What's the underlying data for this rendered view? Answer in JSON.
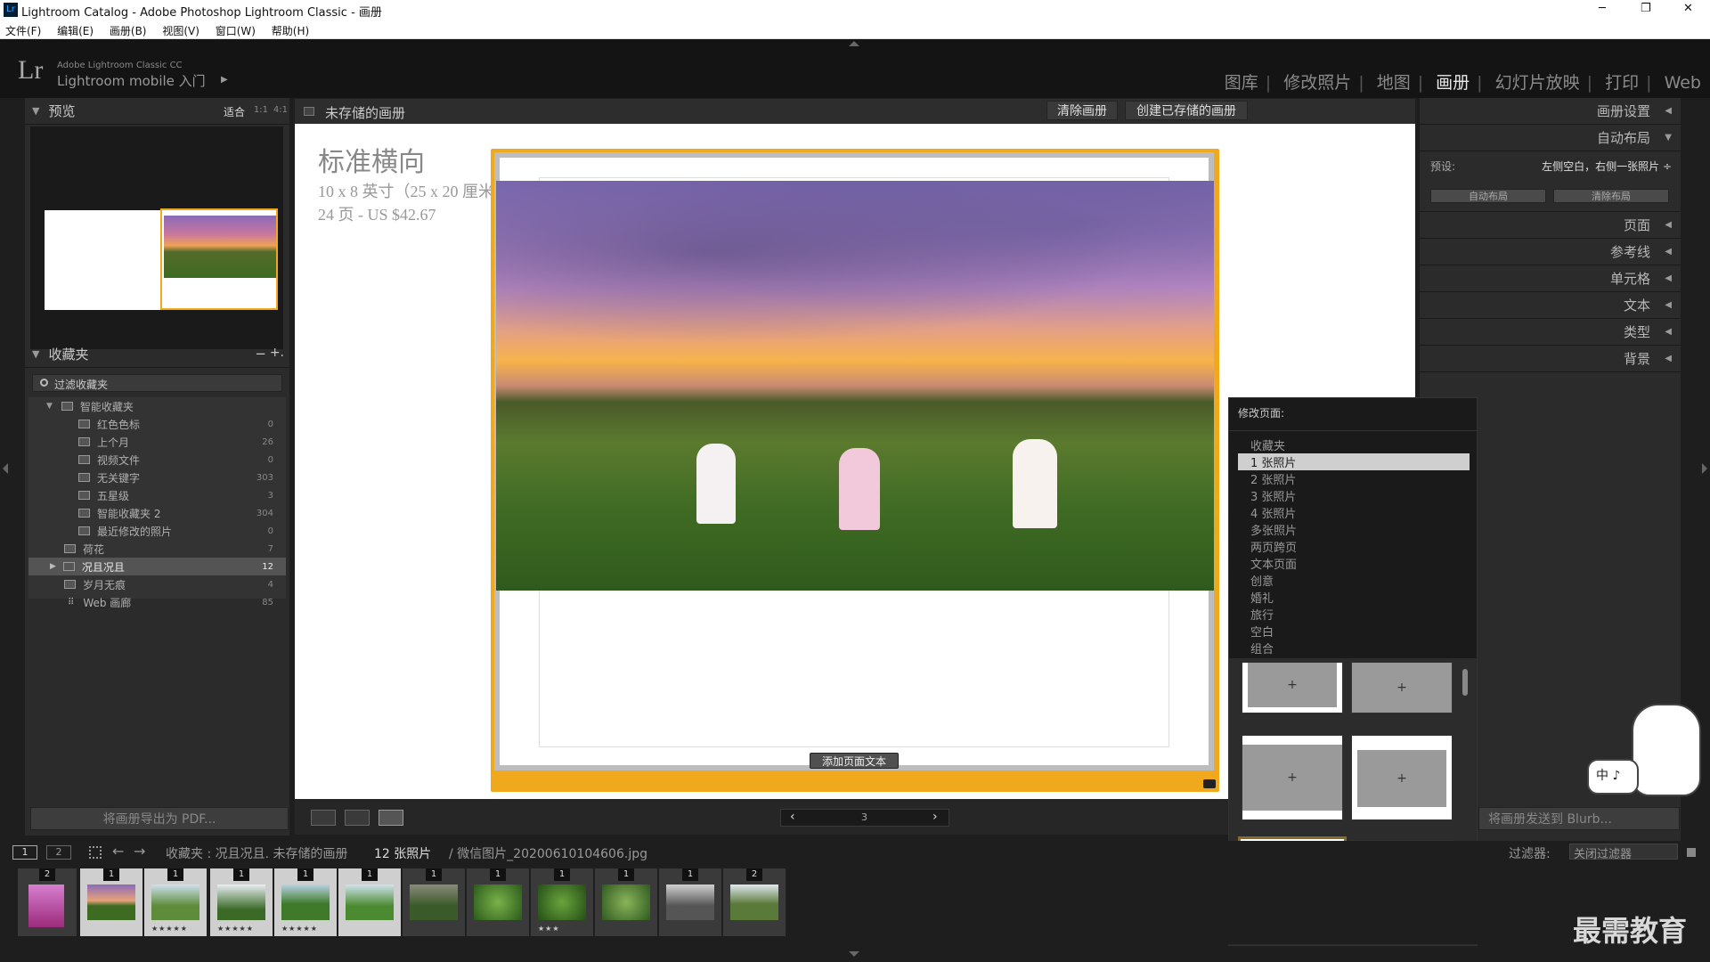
{
  "window": {
    "title": "Lightroom Catalog - Adobe Photoshop Lightroom Classic - 画册",
    "app_icon": "Lr",
    "minimize": "─",
    "maximize": "❐",
    "close": "✕"
  },
  "menu": [
    "文件(F)",
    "编辑(E)",
    "画册(B)",
    "视图(V)",
    "窗口(W)",
    "帮助(H)"
  ],
  "identity": {
    "logo": "Lr",
    "line1": "Adobe Lightroom Classic CC",
    "line2": "Lightroom mobile 入门",
    "arrow": "▶"
  },
  "modules": {
    "library": "图库",
    "develop": "修改照片",
    "map": "地图",
    "book": "画册",
    "slideshow": "幻灯片放映",
    "print": "打印",
    "web": "Web",
    "sep": "|"
  },
  "preview": {
    "header": "预览",
    "zoom_fit": "适合",
    "zoom_1": "1:1",
    "zoom_4": "4:1"
  },
  "collections": {
    "header": "收藏夹",
    "minus": "−",
    "plus": "+.",
    "filter_placeholder": "过滤收藏夹",
    "smart_set": "智能收藏夹",
    "smart_items": [
      {
        "label": "红色色标",
        "count": "0"
      },
      {
        "label": "上个月",
        "count": "26"
      },
      {
        "label": "视频文件",
        "count": "0"
      },
      {
        "label": "无关键字",
        "count": "303"
      },
      {
        "label": "五星级",
        "count": "3"
      },
      {
        "label": "智能收藏夹 2",
        "count": "304"
      },
      {
        "label": "最近修改的照片",
        "count": "0"
      }
    ],
    "items": [
      {
        "label": "荷花",
        "count": "7"
      },
      {
        "label": "况且况且",
        "count": "12"
      },
      {
        "label": "岁月无痕",
        "count": "4"
      },
      {
        "label": "Web 画廊",
        "count": "85"
      }
    ]
  },
  "export_pdf": "将画册导出为 PDF...",
  "center": {
    "title": "未存储的画册",
    "clear_book": "清除画册",
    "create_saved": "创建已存储的画册"
  },
  "book_info": {
    "title": "标准横向",
    "size": "10 x 8 英寸（25 x 20 厘米）",
    "price": "24 页 - US $42.67"
  },
  "page": {
    "add_text": "添加页面文本",
    "page_number": "3",
    "prev": "‹",
    "next": "›"
  },
  "right": {
    "book_settings": "画册设置",
    "auto_layout": "自动布局",
    "preset_label": "预设:",
    "preset_value": "左侧空白，右侧一张照片 ÷",
    "auto_btn": "自动布局",
    "clear_btn": "清除布局",
    "sections": [
      "页面",
      "参考线",
      "单元格",
      "文本",
      "类型",
      "背景"
    ],
    "send_blurb": "将画册发送到 Blurb..."
  },
  "popup": {
    "title": "修改页面:",
    "items": [
      "收藏夹",
      "1 张照片",
      "2 张照片",
      "3 张照片",
      "4 张照片",
      "多张照片",
      "两页跨页",
      "文本页面",
      "创意",
      "婚礼",
      "旅行",
      "空白",
      "组合"
    ],
    "plus": "+"
  },
  "filmstrip_bar": {
    "screen1": "1",
    "screen2": "2",
    "path": "收藏夹 : 况且况且. 未存储的画册",
    "count": "12 张照片",
    "file": "/ 微信图片_20200610104606.jpg",
    "filter_label": "过滤器:",
    "filter_value": "关闭过滤器"
  },
  "filmstrip": [
    {
      "badge": "2",
      "stars": ""
    },
    {
      "badge": "1",
      "stars": ""
    },
    {
      "badge": "1",
      "stars": "★★★★★"
    },
    {
      "badge": "1",
      "stars": "★★★★★"
    },
    {
      "badge": "1",
      "stars": "★★★★★"
    },
    {
      "badge": "1",
      "stars": ""
    },
    {
      "badge": "1",
      "stars": ""
    },
    {
      "badge": "1",
      "stars": ""
    },
    {
      "badge": "1",
      "stars": "★★★"
    },
    {
      "badge": "1",
      "stars": ""
    },
    {
      "badge": "1",
      "stars": ""
    },
    {
      "badge": "2",
      "stars": ""
    }
  ],
  "ime": {
    "label": "中 ♪"
  },
  "watermark": "最需教育",
  "colors": {
    "accent_yellow": "#f0a81c",
    "panel": "#2b2b2b",
    "canvas": "#ffffff"
  }
}
